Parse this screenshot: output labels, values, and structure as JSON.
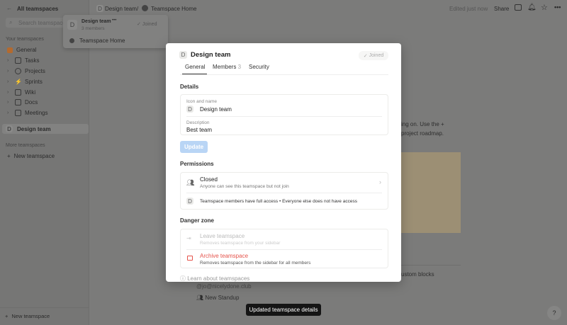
{
  "topbar": {
    "back_label": "All teamspaces",
    "breadcrumb_team": "Design team",
    "breadcrumb_sep": "/",
    "breadcrumb_page": "Teamspace Home",
    "edited": "Edited just now",
    "share": "Share"
  },
  "sidebar": {
    "search_placeholder": "Search teamspaces",
    "your_heading": "Your teamspaces",
    "items": [
      {
        "label": "General"
      },
      {
        "label": "Tasks"
      },
      {
        "label": "Projects"
      },
      {
        "label": "Sprints"
      },
      {
        "label": "Wiki"
      },
      {
        "label": "Docs"
      },
      {
        "label": "Meetings"
      }
    ],
    "active": "Design team",
    "more_heading": "More teamspaces",
    "new_teamspace": "New teamspace",
    "footer_new": "New teamspace"
  },
  "popover": {
    "title": "Design team",
    "members": "3 members",
    "joined": "Joined",
    "page": "Teamspace Home",
    "more": "•••"
  },
  "modal": {
    "icon_letter": "D",
    "title": "Design team",
    "joined": "Joined",
    "tabs": [
      {
        "label": "General"
      },
      {
        "label": "Members",
        "count": "3"
      },
      {
        "label": "Security"
      }
    ],
    "details_heading": "Details",
    "icon_name_label": "Icon and name",
    "name_value": "Design team",
    "description_label": "Description",
    "description_value": "Best team",
    "update": "Update",
    "permissions_heading": "Permissions",
    "perm_title": "Closed",
    "perm_sub": "Anyone can see this teamspace but not join",
    "access_members": "Teamspace members have full access",
    "access_sep": "•",
    "access_others": "Everyone else does not have access",
    "danger_heading": "Danger zone",
    "leave_title": "Leave teamspace",
    "leave_sub": "Removes teamspace from your sidebar",
    "archive_title": "Archive teamspace",
    "archive_sub": "Removes teamspace from the sidebar for all members",
    "learn": "Learn about teamspaces"
  },
  "page": {
    "line1": "ing on. Use the +",
    "line2": "project roadmap.",
    "custom": "ustom blocks",
    "email": "@jo@nicelydone.club",
    "standup": "New Standup"
  },
  "toast": "Updated teamspace details",
  "help": "?",
  "colors": {
    "danger": "#e5534b",
    "update_bg": "#b9d5f5",
    "tan": "#9c8f74"
  }
}
